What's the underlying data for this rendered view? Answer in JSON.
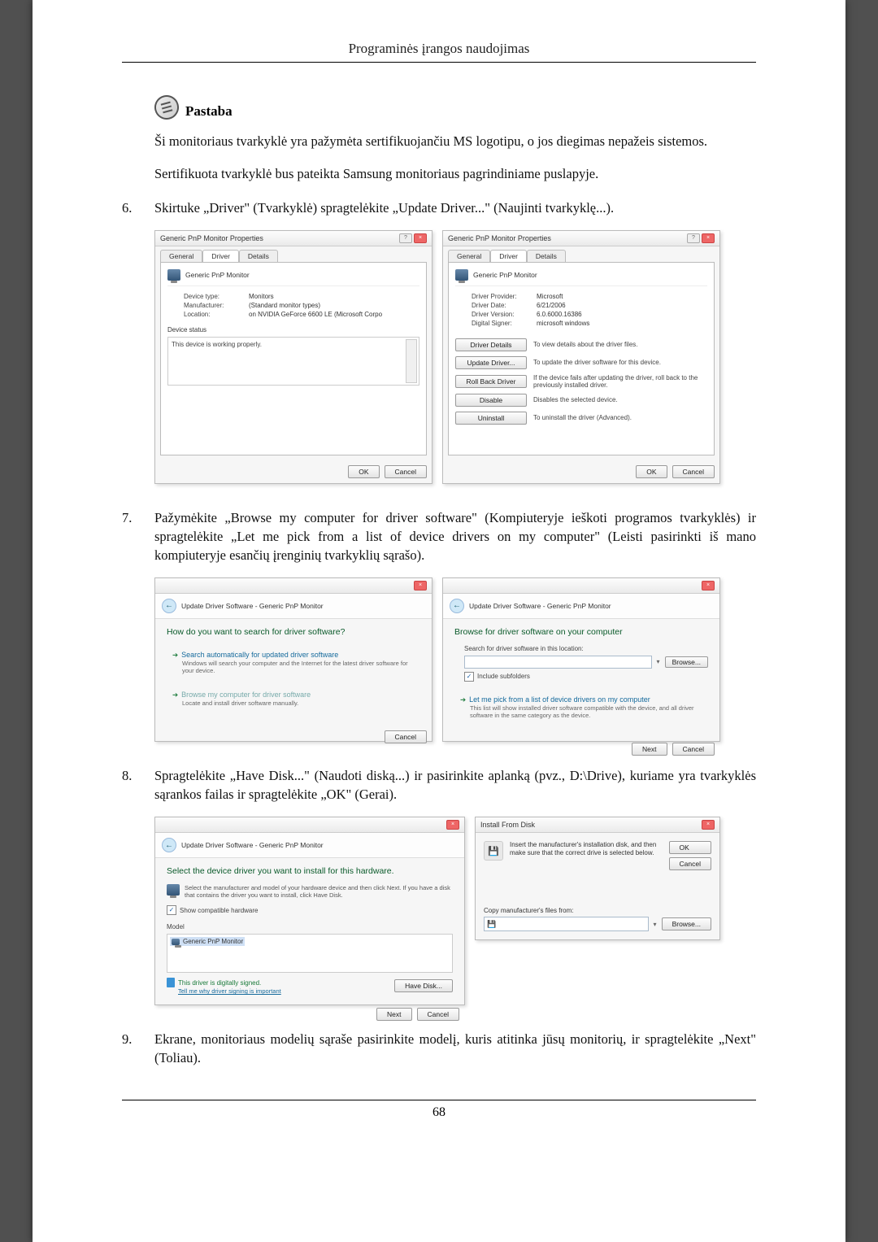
{
  "header": "Programinės įrangos naudojimas",
  "note": {
    "title": "Pastaba",
    "p1": "Ši monitoriaus tvarkyklė yra pažymėta sertifikuojančiu MS logotipu, o jos diegimas nepažeis sistemos.",
    "p2": "Sertifikuota tvarkyklė bus pateikta Samsung monitoriaus pagrindiniame puslapyje."
  },
  "step6": {
    "num": "6.",
    "text": "Skirtuke „Driver\" (Tvarkyklė) spragtelėkite „Update Driver...\" (Naujinti tvarkyklę...)."
  },
  "shotA": {
    "title": "Generic PnP Monitor Properties",
    "tabs": {
      "general": "General",
      "driver": "Driver",
      "details": "Details"
    },
    "heading": "Generic PnP Monitor",
    "rows": {
      "devtype_k": "Device type:",
      "devtype_v": "Monitors",
      "manu_k": "Manufacturer:",
      "manu_v": "(Standard monitor types)",
      "loc_k": "Location:",
      "loc_v": "on NVIDIA GeForce 6600 LE (Microsoft Corpo"
    },
    "status_label": "Device status",
    "status_text": "This device is working properly.",
    "ok": "OK",
    "cancel": "Cancel"
  },
  "shotB": {
    "title": "Generic PnP Monitor Properties",
    "tabs": {
      "general": "General",
      "driver": "Driver",
      "details": "Details"
    },
    "heading": "Generic PnP Monitor",
    "rows": {
      "prov_k": "Driver Provider:",
      "prov_v": "Microsoft",
      "date_k": "Driver Date:",
      "date_v": "6/21/2006",
      "ver_k": "Driver Version:",
      "ver_v": "6.0.6000.16386",
      "sign_k": "Digital Signer:",
      "sign_v": "microsoft windows"
    },
    "btns": {
      "details": "Driver Details",
      "details_d": "To view details about the driver files.",
      "update": "Update Driver...",
      "update_d": "To update the driver software for this device.",
      "roll": "Roll Back Driver",
      "roll_d": "If the device fails after updating the driver, roll back to the previously installed driver.",
      "disable": "Disable",
      "disable_d": "Disables the selected device.",
      "uninst": "Uninstall",
      "uninst_d": "To uninstall the driver (Advanced)."
    },
    "ok": "OK",
    "cancel": "Cancel"
  },
  "step7": {
    "num": "7.",
    "text": "Pažymėkite „Browse my computer for driver software\" (Kompiuteryje ieškoti programos tvarkyklės) ir spragtelėkite „Let me pick from a list of device drivers on my computer\" (Leisti pasirinkti iš mano kompiuteryje esančių įrenginių tvarkyklių sąrašo)."
  },
  "shotC": {
    "crumb": "Update Driver Software - Generic PnP Monitor",
    "head": "How do you want to search for driver software?",
    "opt1_t": "Search automatically for updated driver software",
    "opt1_s": "Windows will search your computer and the Internet for the latest driver software for your device.",
    "opt2_t": "Browse my computer for driver software",
    "opt2_s": "Locate and install driver software manually.",
    "cancel": "Cancel"
  },
  "shotD": {
    "crumb": "Update Driver Software - Generic PnP Monitor",
    "head": "Browse for driver software on your computer",
    "loc_label": "Search for driver software in this location:",
    "browse": "Browse...",
    "chk": "Include subfolders",
    "opt_t": "Let me pick from a list of device drivers on my computer",
    "opt_s": "This list will show installed driver software compatible with the device, and all driver software in the same category as the device.",
    "next": "Next",
    "cancel": "Cancel"
  },
  "step8": {
    "num": "8.",
    "text": "Spragtelėkite „Have Disk...\" (Naudoti diską...) ir pasirinkite aplanką (pvz., D:\\Drive), kuriame yra tvarkyklės sąrankos failas ir spragtelėkite „OK\" (Gerai)."
  },
  "shotE": {
    "crumb": "Update Driver Software - Generic PnP Monitor",
    "head": "Select the device driver you want to install for this hardware.",
    "sub": "Select the manufacturer and model of your hardware device and then click Next. If you have a disk that contains the driver you want to install, click Have Disk.",
    "chk": "Show compatible hardware",
    "model_label": "Model",
    "model_item": "Generic PnP Monitor",
    "signed": "This driver is digitally signed.",
    "tell": "Tell me why driver signing is important",
    "have": "Have Disk...",
    "next": "Next",
    "cancel": "Cancel"
  },
  "shotF": {
    "title": "Install From Disk",
    "msg": "Insert the manufacturer's installation disk, and then make sure that the correct drive is selected below.",
    "copy": "Copy manufacturer's files from:",
    "ok": "OK",
    "cancel": "Cancel",
    "browse": "Browse..."
  },
  "step9": {
    "num": "9.",
    "text": "Ekrane, monitoriaus modelių sąraše pasirinkite modelį, kuris atitinka jūsų monitorių, ir spragtelėkite „Next\" (Toliau)."
  },
  "pagenum": "68"
}
